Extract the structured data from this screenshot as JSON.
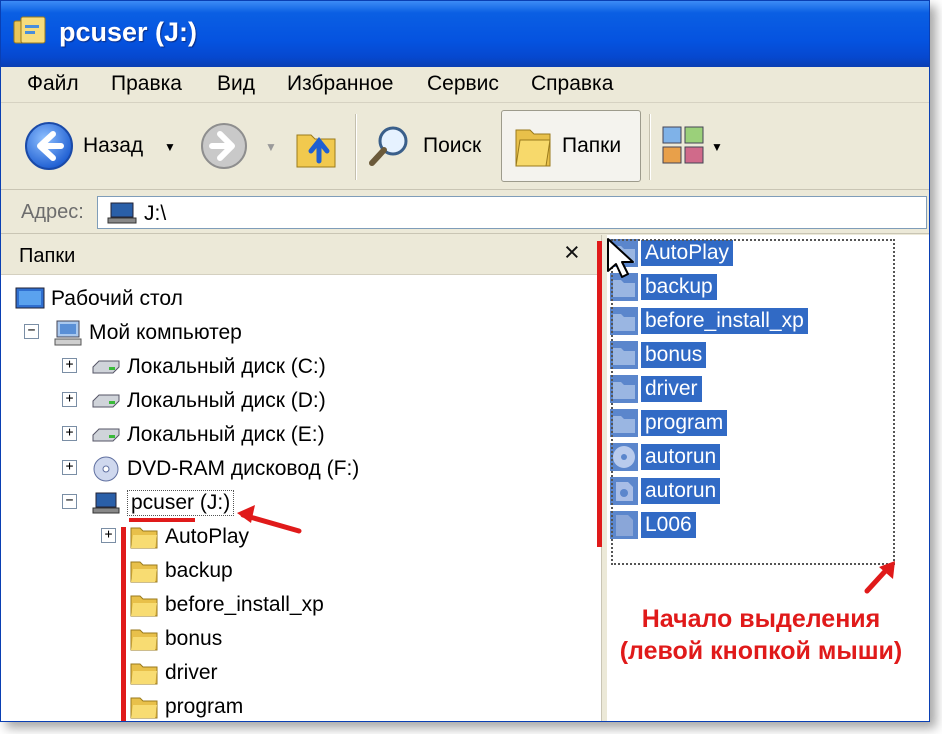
{
  "window": {
    "title": "pcuser (J:)"
  },
  "menu": [
    "Файл",
    "Правка",
    "Вид",
    "Избранное",
    "Сервис",
    "Справка"
  ],
  "toolbar": {
    "back": "Назад",
    "search": "Поиск",
    "folders": "Папки"
  },
  "address": {
    "label": "Адрес:",
    "value": "J:\\"
  },
  "folders_pane": {
    "title": "Папки",
    "close": "×",
    "tree": {
      "desktop": "Рабочий стол",
      "my_computer": "Мой компьютер",
      "drives": [
        "Локальный диск (C:)",
        "Локальный диск (D:)",
        "Локальный диск (E:)",
        "DVD-RAM дисковод (F:)"
      ],
      "current": "pcuser (J:)",
      "children": [
        "AutoPlay",
        "backup",
        "before_install_xp",
        "bonus",
        "driver",
        "program"
      ]
    }
  },
  "files": [
    {
      "name": "AutoPlay",
      "icon": "folder-icon"
    },
    {
      "name": "backup",
      "icon": "folder-icon"
    },
    {
      "name": "before_install_xp",
      "icon": "folder-icon"
    },
    {
      "name": "bonus",
      "icon": "folder-icon"
    },
    {
      "name": "driver",
      "icon": "folder-icon"
    },
    {
      "name": "program",
      "icon": "folder-icon"
    },
    {
      "name": "autorun",
      "icon": "cd-icon"
    },
    {
      "name": "autorun",
      "icon": "settings-file-icon"
    },
    {
      "name": "L006",
      "icon": "file-icon"
    }
  ],
  "annotation": {
    "line1": "Начало выделения",
    "line2": "(левой кнопкой мыши)"
  },
  "colors": {
    "selection": "#316ac5",
    "annotation": "#e01a1a",
    "titlebar": "#0553e0"
  }
}
